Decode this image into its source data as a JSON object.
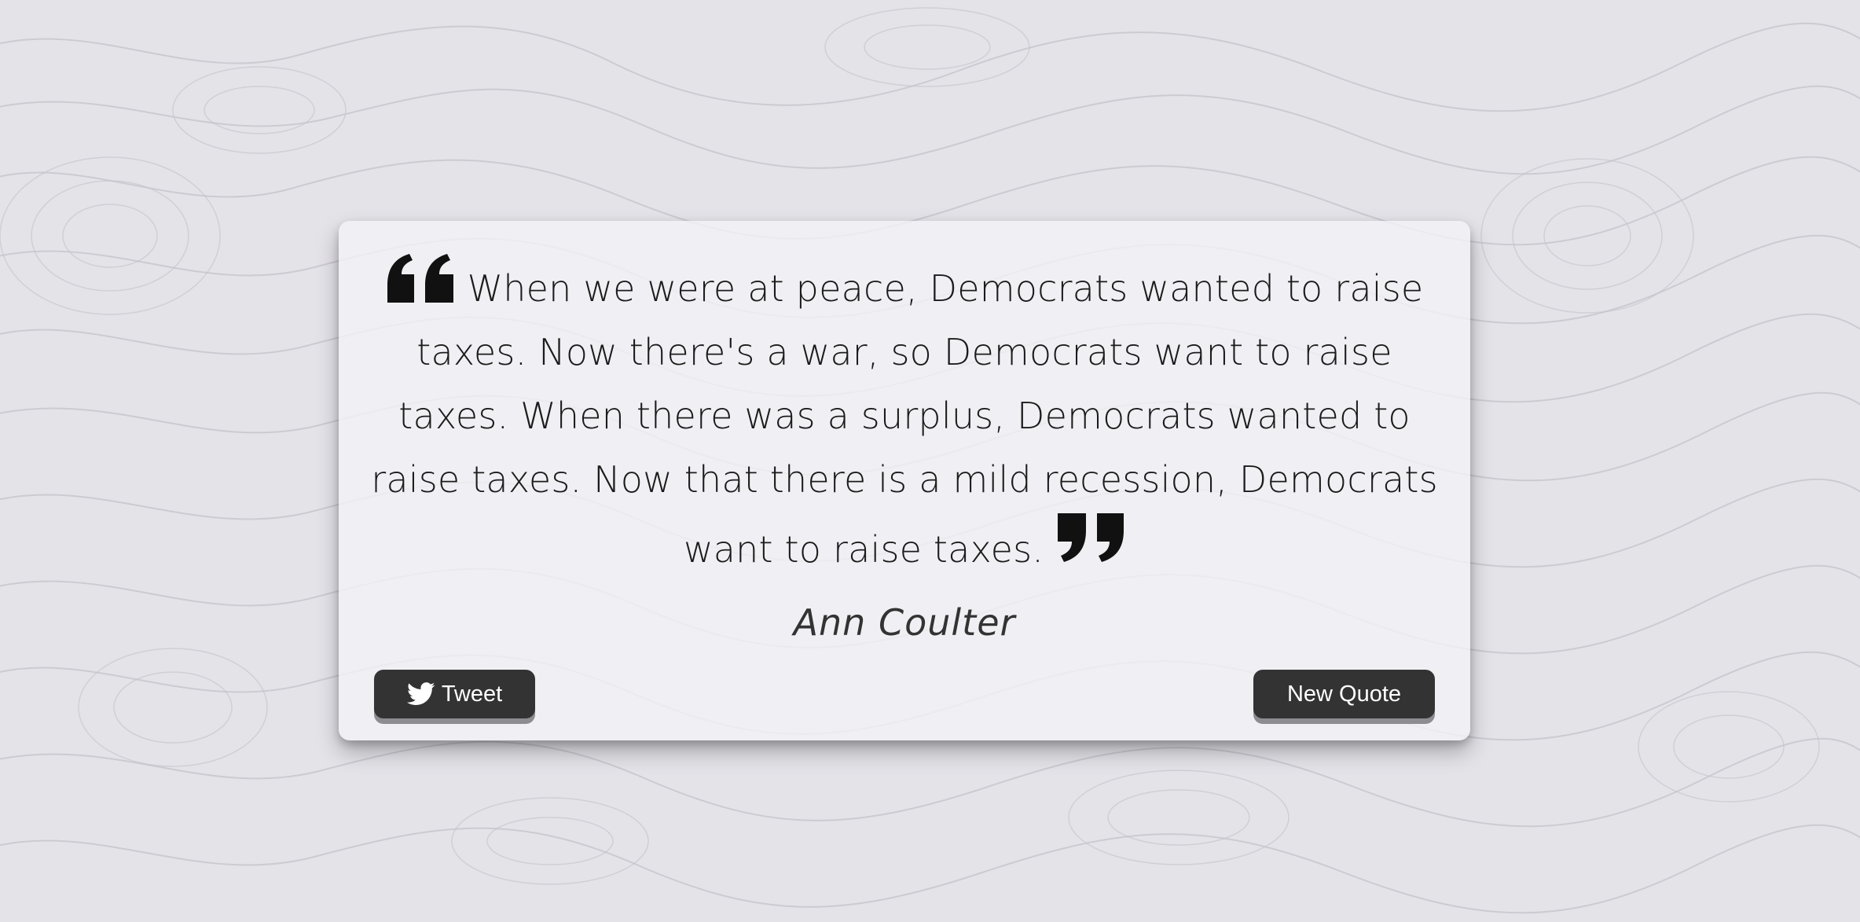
{
  "quote": {
    "text": "When we were at peace, Democrats wanted to raise taxes. Now there's a war, so Democrats want to raise taxes. When there was a surplus, Democrats wanted to raise taxes. Now that there is a mild recession, Democrats want to raise taxes.",
    "author": "Ann Coulter",
    "open_icon": "quote-left-icon",
    "close_icon": "quote-right-icon"
  },
  "buttons": {
    "tweet_label": "Tweet",
    "tweet_icon": "twitter-icon",
    "new_quote_label": "New Quote"
  },
  "colors": {
    "background": "#e4e3e8",
    "card": "#f2f1f5",
    "button": "#333333",
    "button_text": "#ffffff",
    "button_shadow": "#8d8c91",
    "text": "#1b1b1b"
  }
}
